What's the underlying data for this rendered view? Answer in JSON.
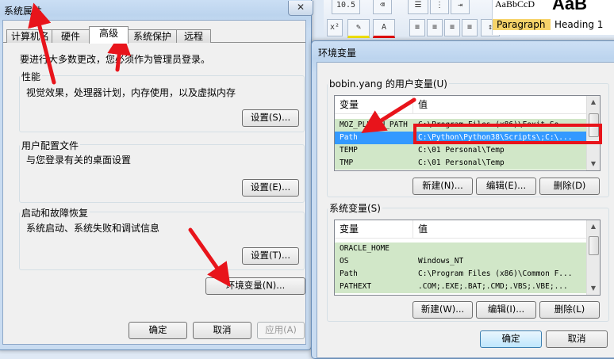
{
  "background_app": {
    "font_size": "10.5",
    "style_gallery": {
      "sample1": "AaBbCcD",
      "sample2": "AaB",
      "label1": "Paragraph",
      "label2": "Heading 1"
    }
  },
  "sys_props": {
    "title": "系统属性",
    "close": "✕",
    "tabs": [
      "计算机名",
      "硬件",
      "高级",
      "系统保护",
      "远程"
    ],
    "active_tab": "高级",
    "admin_note": "要进行大多数更改，您必须作为管理员登录。",
    "performance": {
      "title": "性能",
      "desc": "视觉效果，处理器计划，内存使用，以及虚拟内存",
      "button": "设置(S)..."
    },
    "user_profiles": {
      "title": "用户配置文件",
      "desc": "与您登录有关的桌面设置",
      "button": "设置(E)..."
    },
    "startup": {
      "title": "启动和故障恢复",
      "desc": "系统启动、系统失败和调试信息",
      "button": "设置(T)..."
    },
    "env_button": "环境变量(N)...",
    "ok": "确定",
    "cancel": "取消",
    "apply": "应用(A)"
  },
  "env_vars": {
    "title": "环境变量",
    "user_group_title": "bobin.yang 的用户变量(U)",
    "system_group_title": "系统变量(S)",
    "columns": {
      "name": "变量",
      "value": "值"
    },
    "user_rows": [
      {
        "name": "MOZ_PLUGIN_PATH",
        "value": "C:\\Program Files (x86)\\Foxit So..."
      },
      {
        "name": "Path",
        "value": "C:\\Python\\Python38\\Scripts\\;C:\\...",
        "selected": true
      },
      {
        "name": "TEMP",
        "value": "C:\\01 Personal\\Temp"
      },
      {
        "name": "TMP",
        "value": "C:\\01 Personal\\Temp"
      }
    ],
    "system_rows": [
      {
        "name": "ORACLE_HOME",
        "value": ""
      },
      {
        "name": "OS",
        "value": "Windows_NT"
      },
      {
        "name": "Path",
        "value": "C:\\Program Files (x86)\\Common F..."
      },
      {
        "name": "PATHEXT",
        "value": ".COM;.EXE;.BAT;.CMD;.VBS;.VBE;..."
      }
    ],
    "buttons": {
      "new_user": "新建(N)...",
      "edit_user": "编辑(E)...",
      "delete_user": "删除(D)",
      "new_sys": "新建(W)...",
      "edit_sys": "编辑(I)...",
      "delete_sys": "删除(L)",
      "ok": "确定",
      "cancel": "取消"
    }
  },
  "colors": {
    "annotation": "#e8141b",
    "selection": "#3399ff",
    "row_bg": "#d1e7c8"
  }
}
